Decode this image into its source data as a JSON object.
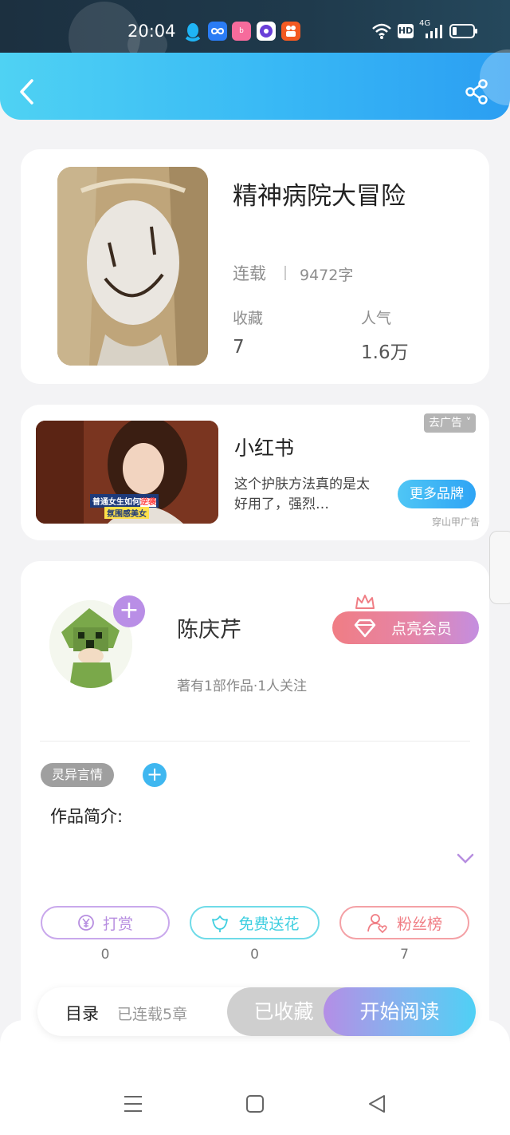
{
  "status_bar": {
    "time": "20:04",
    "signal": "4G",
    "hd": "HD"
  },
  "header": {
    "back_icon": "chevron-left-icon",
    "share_icon": "share-icon"
  },
  "book": {
    "title": "精神病院大冒险",
    "status": "连载",
    "word_count": "9472字",
    "favorites_label": "收藏",
    "favorites_value": "7",
    "popularity_label": "人气",
    "popularity_value": "1.6万"
  },
  "ad": {
    "close_label": "去广告",
    "brand": "小红书",
    "desc": "这个护肤方法真的是太好用了，强烈…",
    "cta": "更多品牌",
    "source": "穿山甲广告",
    "image_caption_1": "普通女生如何",
    "image_caption_highlight": "逆袭",
    "image_caption_2": "氛围感美女"
  },
  "author": {
    "name": "陈庆芹",
    "stats": "著有1部作品·1人关注",
    "vip_button": "点亮会员"
  },
  "tags": {
    "genre": "灵异言情"
  },
  "intro": {
    "label": "作品简介:"
  },
  "actions": [
    {
      "label": "打赏",
      "count": "0",
      "icon": "yen-icon",
      "color": "#b78ee0"
    },
    {
      "label": "免费送花",
      "count": "0",
      "icon": "flower-icon",
      "color": "#3fcfe0"
    },
    {
      "label": "粉丝榜",
      "count": "7",
      "icon": "fans-icon",
      "color": "#f07d84"
    }
  ],
  "bottom_bar": {
    "catalog": "目录",
    "chapters": "已连载5章",
    "collected": "已收藏",
    "read": "开始阅读"
  },
  "colors": {
    "accent": "#38b8f5",
    "vip": "#f07d84",
    "purple": "#b78ee0"
  }
}
